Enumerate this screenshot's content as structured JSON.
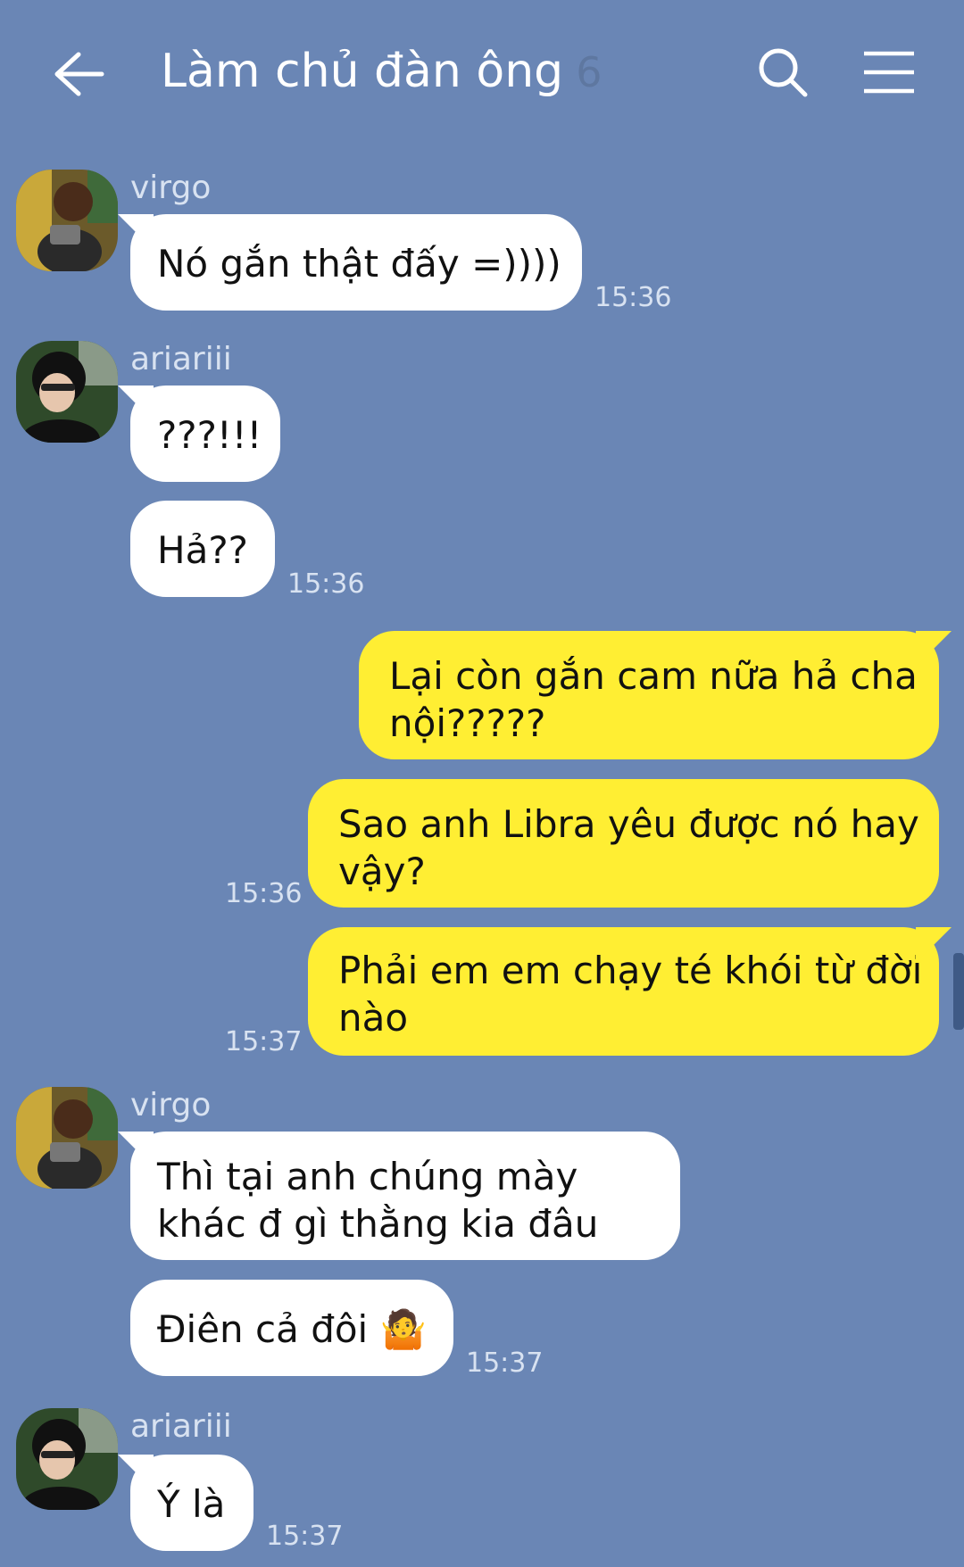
{
  "header": {
    "title": "Làm chủ đàn ông",
    "member_count": "6",
    "back_icon": "arrow-left-icon",
    "search_icon": "search-icon",
    "menu_icon": "hamburger-menu-icon"
  },
  "colors": {
    "background": "#6a86b5",
    "incoming_bubble": "#ffffff",
    "outgoing_bubble": "#ffee33"
  },
  "messages": [
    {
      "sender": "virgo",
      "text": "Nó gắn thật đấy =))))",
      "time": "15:36"
    },
    {
      "sender": "ariariii",
      "text": "???!!!"
    },
    {
      "text": "Hả??",
      "time": "15:36"
    },
    {
      "outgoing": true,
      "line1": "Lại còn gắn cam nữa hả cha",
      "line2": "nội?????"
    },
    {
      "outgoing": true,
      "line1": "Sao anh Libra yêu được nó hay",
      "line2": "vậy?",
      "time": "15:36"
    },
    {
      "outgoing": true,
      "line1": "Phải em em chạy té khói từ đời",
      "line2": "nào",
      "time": "15:37"
    },
    {
      "sender": "virgo",
      "line1": "Thì tại anh chúng mày",
      "line2": "khác đ gì thằng kia đâu"
    },
    {
      "text": "Điên cả đôi 🤷",
      "time": "15:37"
    },
    {
      "sender": "ariariii",
      "text": "Ý là",
      "time": "15:37"
    }
  ]
}
